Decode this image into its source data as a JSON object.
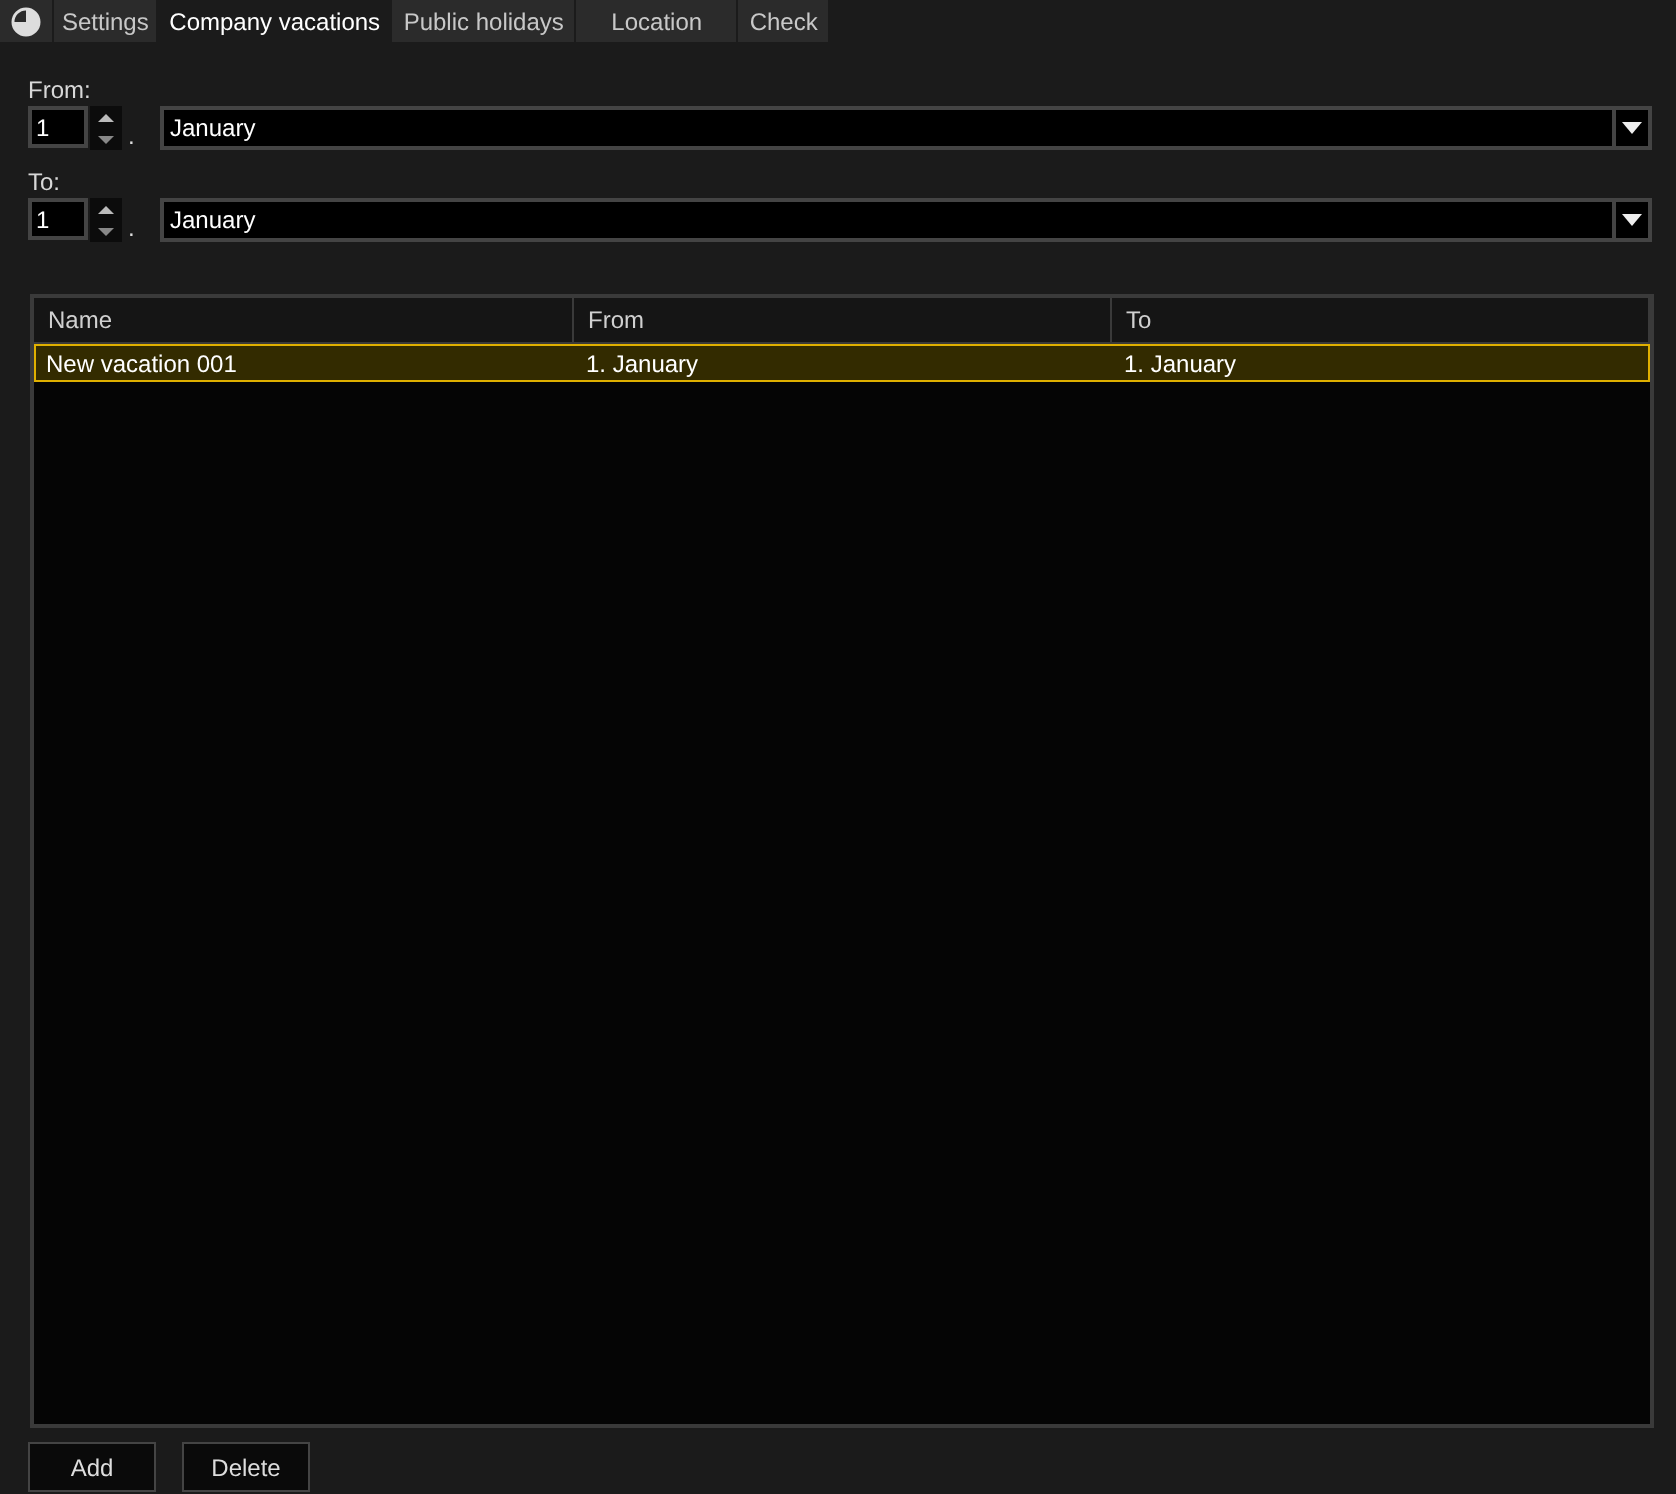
{
  "tabs": [
    {
      "label": "Settings",
      "selected": false
    },
    {
      "label": "Company vacations",
      "selected": true
    },
    {
      "label": "Public holidays",
      "selected": false
    },
    {
      "label": "Location",
      "selected": false
    },
    {
      "label": "Check",
      "selected": false
    }
  ],
  "ranges": [
    {
      "label": "From:",
      "day": "1",
      "separator": ".",
      "month": "January"
    },
    {
      "label": "To:",
      "day": "1",
      "separator": ".",
      "month": "January"
    }
  ],
  "table": {
    "columns": [
      "Name",
      "From",
      "To"
    ],
    "rows": [
      {
        "cells": [
          "New vacation 001",
          "1. January",
          "1. January"
        ],
        "selected": true
      }
    ]
  },
  "buttons": [
    "Add",
    "Delete"
  ]
}
